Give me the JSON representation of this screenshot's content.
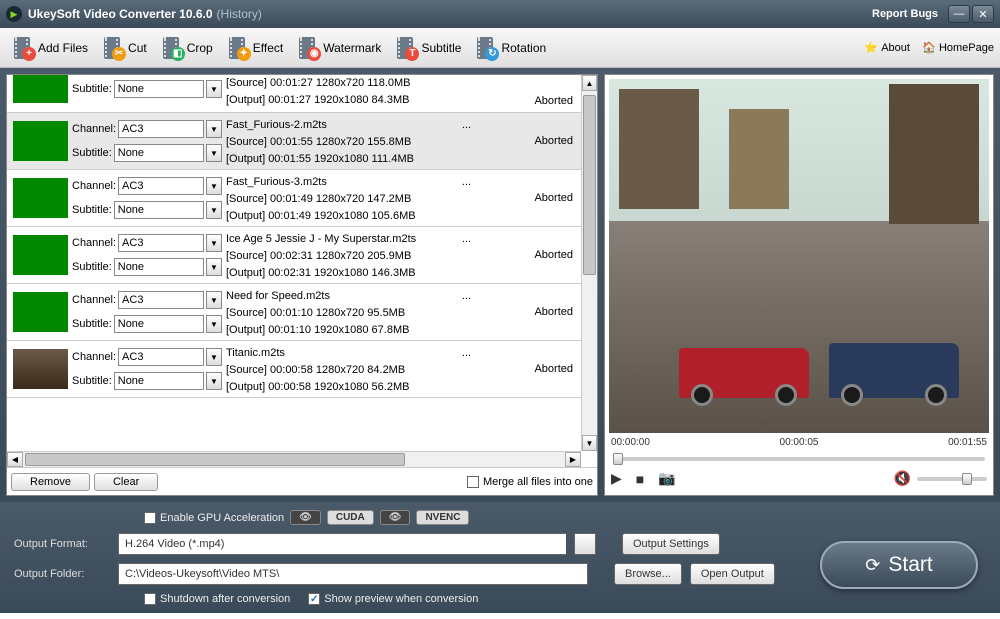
{
  "title": {
    "app": "UkeySoft Video Converter 10.6.0",
    "suffix": "(History)",
    "report": "Report Bugs"
  },
  "toolbar": {
    "add": "Add Files",
    "cut": "Cut",
    "crop": "Crop",
    "effect": "Effect",
    "watermark": "Watermark",
    "subtitle": "Subtitle",
    "rotation": "Rotation",
    "about": "About",
    "home": "HomePage"
  },
  "labels": {
    "channel": "Channel:",
    "subtitle": "Subtitle:",
    "remove": "Remove",
    "clear": "Clear",
    "merge": "Merge all files into one",
    "gpu": "Enable GPU Acceleration",
    "cuda": "CUDA",
    "nvenc": "NVENC",
    "outfmt": "Output Format:",
    "outfolder": "Output Folder:",
    "outsettings": "Output Settings",
    "browse": "Browse...",
    "openout": "Open Output",
    "shutdown": "Shutdown after conversion",
    "preview": "Show preview when conversion",
    "start": "Start"
  },
  "files": [
    {
      "channel": "",
      "subtitle": "None",
      "name": "",
      "src": "[Source]  00:01:27  1280x720  118.0MB",
      "out": "[Output]  00:01:27  1920x1080  84.3MB",
      "status": "Aborted",
      "thumb": "green",
      "top": true
    },
    {
      "channel": "AC3",
      "subtitle": "None",
      "name": "Fast_Furious-2.m2ts",
      "src": "[Source]  00:01:55  1280x720  155.8MB",
      "out": "[Output]  00:01:55  1920x1080  111.4MB",
      "status": "Aborted",
      "thumb": "green",
      "sel": true
    },
    {
      "channel": "AC3",
      "subtitle": "None",
      "name": "Fast_Furious-3.m2ts",
      "src": "[Source]  00:01:49  1280x720  147.2MB",
      "out": "[Output]  00:01:49  1920x1080  105.6MB",
      "status": "Aborted",
      "thumb": "green"
    },
    {
      "channel": "AC3",
      "subtitle": "None",
      "name": "Ice Age 5  Jessie J - My Superstar.m2ts",
      "src": "[Source]  00:02:31  1280x720  205.9MB",
      "out": "[Output]  00:02:31  1920x1080  146.3MB",
      "status": "Aborted",
      "thumb": "green"
    },
    {
      "channel": "AC3",
      "subtitle": "None",
      "name": "Need for Speed.m2ts",
      "src": "[Source]  00:01:10  1280x720  95.5MB",
      "out": "[Output]  00:01:10  1920x1080  67.8MB",
      "status": "Aborted",
      "thumb": "green"
    },
    {
      "channel": "AC3",
      "subtitle": "None",
      "name": "Titanic.m2ts",
      "src": "[Source]  00:00:58  1280x720  84.2MB",
      "out": "[Output]  00:00:58  1920x1080  56.2MB",
      "status": "Aborted",
      "thumb": "movie"
    }
  ],
  "preview": {
    "t1": "00:00:00",
    "t2": "00:00:05",
    "t3": "00:01:55"
  },
  "output": {
    "format": "H.264 Video (*.mp4)",
    "folder": "C:\\Videos-Ukeysoft\\Video MTS\\"
  }
}
